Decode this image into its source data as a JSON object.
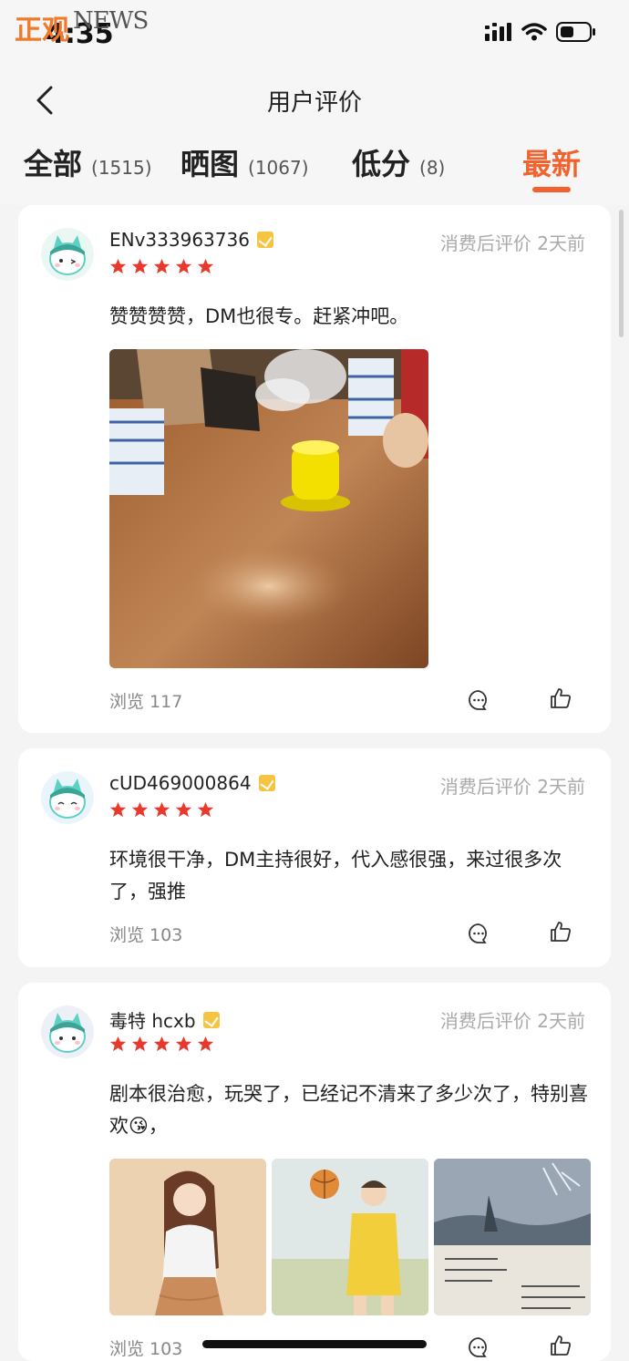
{
  "status_bar": {
    "time": "4:35",
    "watermark_cn": "正观",
    "watermark_en": "NEWS"
  },
  "navbar": {
    "title": "用户评价"
  },
  "tabs": [
    {
      "label": "全部",
      "count": "(1515)"
    },
    {
      "label": "晒图",
      "count": "(1067)"
    },
    {
      "label": "低分",
      "count": "(8)"
    },
    {
      "label": "最新",
      "count": ""
    }
  ],
  "reviews": [
    {
      "username": "ENv333963736",
      "meta": "消费后评价  2天前",
      "rating": 5,
      "text": "赞赞赞赞，DM也很专。赶紧冲吧。",
      "views": "浏览 117"
    },
    {
      "username": "cUD469000864",
      "meta": "消费后评价  2天前",
      "rating": 5,
      "text": "环境很干净，DM主持很好，代入感很强，来过很多次了，强推",
      "views": "浏览 103"
    },
    {
      "username": "毒特 hcxb",
      "meta": "消费后评价  2天前",
      "rating": 5,
      "text": "剧本很治愈，玩哭了，已经记不清来了多少次了，特别喜欢😘，",
      "views": "浏览 103"
    }
  ],
  "icons": {
    "back": "chevron-left-icon",
    "comment": "comment-icon",
    "like": "thumbs-up-icon",
    "verified": "verified-badge-icon",
    "star": "star-icon"
  },
  "colors": {
    "accent": "#f2622e",
    "star": "#e8392c",
    "badge": "#f5c542",
    "meta_text": "#aaaaaa"
  }
}
